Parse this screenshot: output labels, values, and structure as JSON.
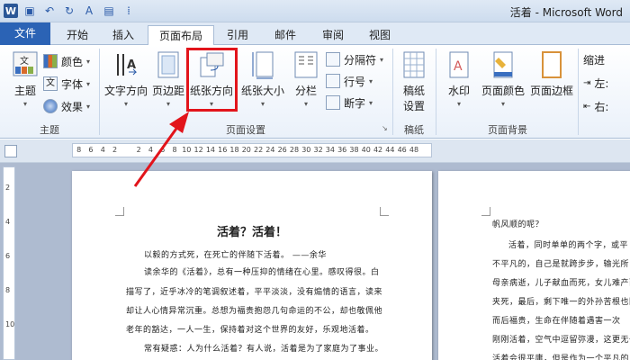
{
  "window": {
    "title": "活着 - Microsoft Word"
  },
  "tabs": [
    "文件",
    "开始",
    "插入",
    "页面布局",
    "引用",
    "邮件",
    "审阅",
    "视图"
  ],
  "active_tab": "页面布局",
  "ribbon": {
    "theme_group": {
      "label": "主题",
      "themes_btn": "主题",
      "colors": "颜色",
      "fonts": "字体",
      "effects": "效果"
    },
    "page_setup_group": {
      "label": "页面设置",
      "text_direction": "文字方向",
      "margins": "页边距",
      "orientation": "纸张方向",
      "size": "纸张大小",
      "columns": "分栏",
      "breaks": "分隔符",
      "line_numbers": "行号",
      "hyphenation": "断字"
    },
    "manuscript_group": {
      "label": "稿纸",
      "manuscript_settings_line1": "稿纸",
      "manuscript_settings_line2": "设置"
    },
    "page_background_group": {
      "label": "页面背景",
      "watermark": "水印",
      "page_color": "页面颜色",
      "page_borders": "页面边框"
    },
    "indent_group": {
      "label": "缩进",
      "left": "左:",
      "right": "右:"
    }
  },
  "ruler": {
    "ticks": [
      "8",
      "6",
      "4",
      "2",
      "",
      "2",
      "4",
      "6",
      "8",
      "10",
      "12",
      "14",
      "16",
      "18",
      "20",
      "22",
      "24",
      "26",
      "28",
      "30",
      "32",
      "34",
      "36",
      "38",
      "40",
      "42",
      "44",
      "46",
      "48"
    ]
  },
  "vruler": {
    "ticks": [
      "2",
      "4",
      "6",
      "8",
      "10"
    ]
  },
  "document": {
    "heading": "活着？活着！",
    "lines": [
      "以毅的方式死，在死亡的伴随下活着。            ——余华",
      "读余华的《活着》，总有一种压抑的情绪在心里。感叹得很。白",
      "描写了，近乎冰冷的笔调叙述着，平平淡淡，没有煽情的语言，读来",
      "却让人心情异常沉重。总想为福贵抱怨几句命运的不公，却也敬佩他",
      "老年的豁达，一人一生，保持着对这个世界的友好，乐观地活着。",
      "常有疑惑：人为什么活着？有人说，活着是为了家庭为了事业。"
    ],
    "page2_lines": [
      "帆风顺的呢？",
      "活着，同时单单的两个字，或平",
      "不平凡的，自己是就跨步步，输光所",
      "母亲病逝，儿子献血而死，女儿难产而",
      "夹死，最后，剩下唯一的外孙苦根也因吃",
      "而后福贵，生命在伴随着遇害一次",
      "刚刚活着，空气中逗留弥漫，这更无一",
      "活着会很平庸，但是作为一个平凡的人"
    ]
  }
}
